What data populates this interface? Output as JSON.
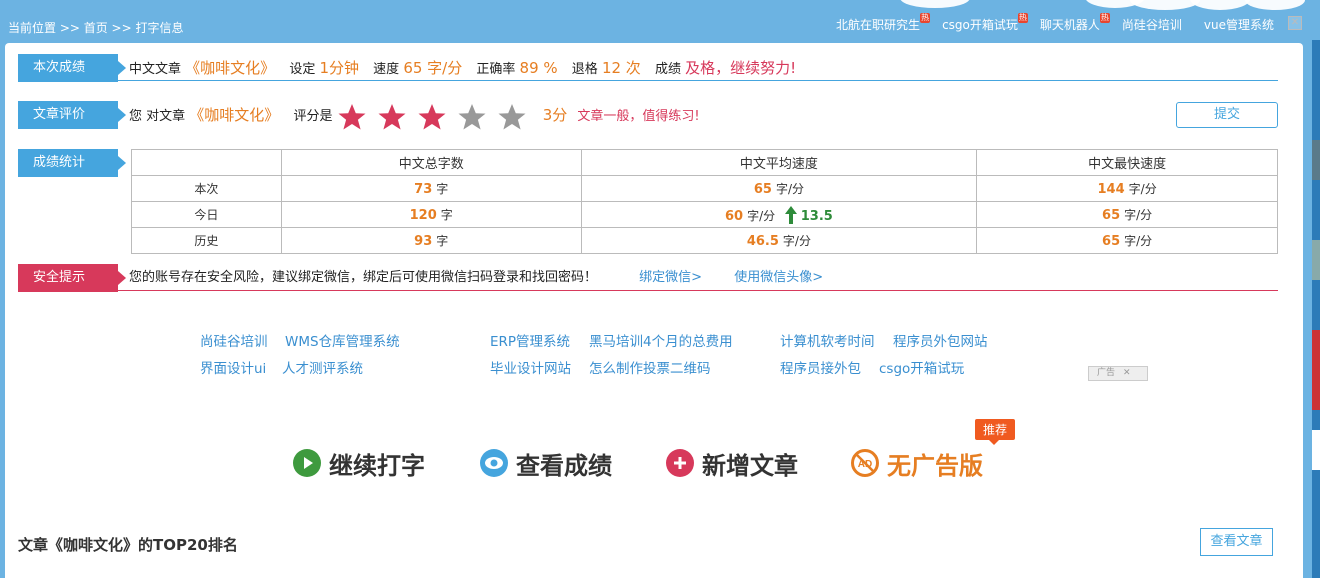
{
  "topbar": {
    "breadcrumb": "当前位置 >> 首页 >> 打字信息",
    "links": [
      {
        "label": "北航在职研究生",
        "hot": "热"
      },
      {
        "label": "csgo开箱试玩",
        "hot": "热"
      },
      {
        "label": "聊天机器人",
        "hot": "热"
      },
      {
        "label": "尚硅谷培训",
        "hot": ""
      },
      {
        "label": "vue管理系统",
        "hot": ""
      }
    ],
    "close": "✕"
  },
  "result": {
    "tag": "本次成绩",
    "article_label": "中文文章",
    "article_title": "《咖啡文化》",
    "setting_label": "设定",
    "setting_value": "1分钟",
    "speed_label": "速度",
    "speed_value": "65 字/分",
    "accuracy_label": "正确率",
    "accuracy_value": "89 %",
    "backspace_label": "退格",
    "backspace_value": "12 次",
    "score_label": "成绩",
    "score_value": "及格，继续努力!"
  },
  "rating": {
    "tag": "文章评价",
    "prefix": "您 对文章",
    "article_title": "《咖啡文化》",
    "label": "评分是",
    "stars_filled": 3,
    "stars_total": 5,
    "score_text": "3分",
    "comment": "文章一般，值得练习!",
    "submit": "提交",
    "colors": {
      "filled": "#d7395b",
      "empty": "#999999"
    }
  },
  "stats": {
    "tag": "成绩统计",
    "headers": [
      "",
      "中文总字数",
      "中文平均速度",
      "中文最快速度"
    ],
    "rows": [
      {
        "label": "本次",
        "total": "73",
        "total_unit": "字",
        "avg": "65",
        "avg_unit": "字/分",
        "up": "",
        "max": "144",
        "max_unit": "字/分"
      },
      {
        "label": "今日",
        "total": "120",
        "total_unit": "字",
        "avg": "60",
        "avg_unit": "字/分",
        "up": "13.5",
        "max": "65",
        "max_unit": "字/分"
      },
      {
        "label": "历史",
        "total": "93",
        "total_unit": "字",
        "avg": "46.5",
        "avg_unit": "字/分",
        "up": "",
        "max": "65",
        "max_unit": "字/分"
      }
    ]
  },
  "security": {
    "tag": "安全提示",
    "text": "您的账号存在安全风险，建议绑定微信，绑定后可使用微信扫码登录和找回密码！",
    "link1": "绑定微信>",
    "link2": "使用微信头像>"
  },
  "ads": {
    "row1": [
      "尚硅谷培训",
      "WMS仓库管理系统",
      "ERP管理系统",
      "黑马培训4个月的总费用",
      "计算机软考时间",
      "程序员外包网站"
    ],
    "row2": [
      "界面设计ui",
      "人才测评系统",
      "毕业设计网站",
      "怎么制作投票二维码",
      "程序员接外包",
      "csgo开箱试玩"
    ],
    "ad_label": "广告"
  },
  "actions": {
    "continue": "继续打字",
    "view_score": "查看成绩",
    "add_article": "新增文章",
    "no_ads": "无广告版",
    "badge": "推荐"
  },
  "ranking": {
    "title": "文章《咖啡文化》的TOP20排名",
    "view_button": "查看文章"
  }
}
